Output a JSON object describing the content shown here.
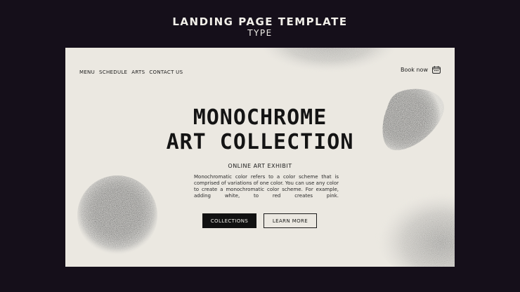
{
  "header": {
    "title": "LANDING PAGE TEMPLATE",
    "subtitle": "TYPE"
  },
  "nav": {
    "items": [
      "MENU",
      "SCHEDULE",
      "ARTS",
      "CONTACT US"
    ]
  },
  "booking": {
    "label": "Book now",
    "icon": "calendar-icon"
  },
  "hero": {
    "title_line1": "MONOCHROME",
    "title_line2": "ART COLLECTION",
    "subtitle": "ONLINE ART EXHIBIT",
    "description": "Monochromatic color refers to a color scheme that is comprised of variations of one color. You can use any color to create a monochromatic color scheme. For example, adding white, to red creates pink."
  },
  "buttons": {
    "primary": "COLLECTIONS",
    "secondary": "LEARN MORE"
  },
  "colors": {
    "background": "#150f1a",
    "card": "#ebe8e1",
    "ink": "#111111"
  }
}
